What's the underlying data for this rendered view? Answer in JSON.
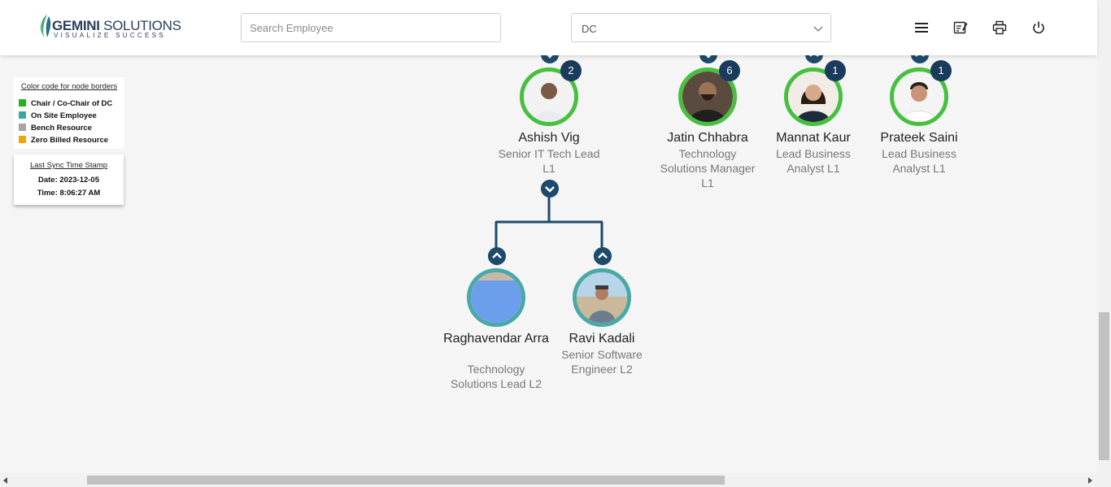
{
  "header": {
    "logo_brand_bold": "GEMINI",
    "logo_brand_rest": " SOLUTIONS",
    "logo_tagline": "VISUALIZE SUCCESS",
    "search_placeholder": "Search Employee",
    "dc_select_value": "DC",
    "icons": [
      "menu-icon",
      "edit-note-icon",
      "print-icon",
      "power-icon"
    ]
  },
  "legend": {
    "title": "Color code for node borders",
    "items": [
      {
        "label": "Chair / Co-Chair of DC",
        "color": "#1eb61e"
      },
      {
        "label": "On Site Employee",
        "color": "#3ba7a3"
      },
      {
        "label": "Bench Resource",
        "color": "#a6a6a6"
      },
      {
        "label": "Zero Billed Resource",
        "color": "#f5a300"
      }
    ]
  },
  "sync": {
    "title": "Last Sync Time Stamp",
    "date": "Date: 2023-12-05",
    "time": "Time: 8:06:27 AM"
  },
  "nodes": [
    {
      "name": "Ashish Vig",
      "role": "Senior IT Tech Lead L1",
      "count": "2",
      "border": "green"
    },
    {
      "name": "Jatin Chhabra",
      "role": "Technology Solutions Manager L1",
      "count": "6",
      "border": "green"
    },
    {
      "name": "Mannat Kaur",
      "role": "Lead Business Analyst L1",
      "count": "1",
      "border": "green"
    },
    {
      "name": "Prateek Saini",
      "role": "Lead Business Analyst L1",
      "count": "1",
      "border": "green"
    },
    {
      "name": "Raghavendar Arra",
      "role": "Technology Solutions Lead L2",
      "border": "teal"
    },
    {
      "name": "Ravi Kadali",
      "role": "Senior Software Engineer L2",
      "border": "teal"
    }
  ],
  "colors": {
    "chair_green": "#46c03e",
    "onsite_teal": "#4aa8a6",
    "badge_navy": "#1b3b5c",
    "connector": "#1e4a6c"
  }
}
